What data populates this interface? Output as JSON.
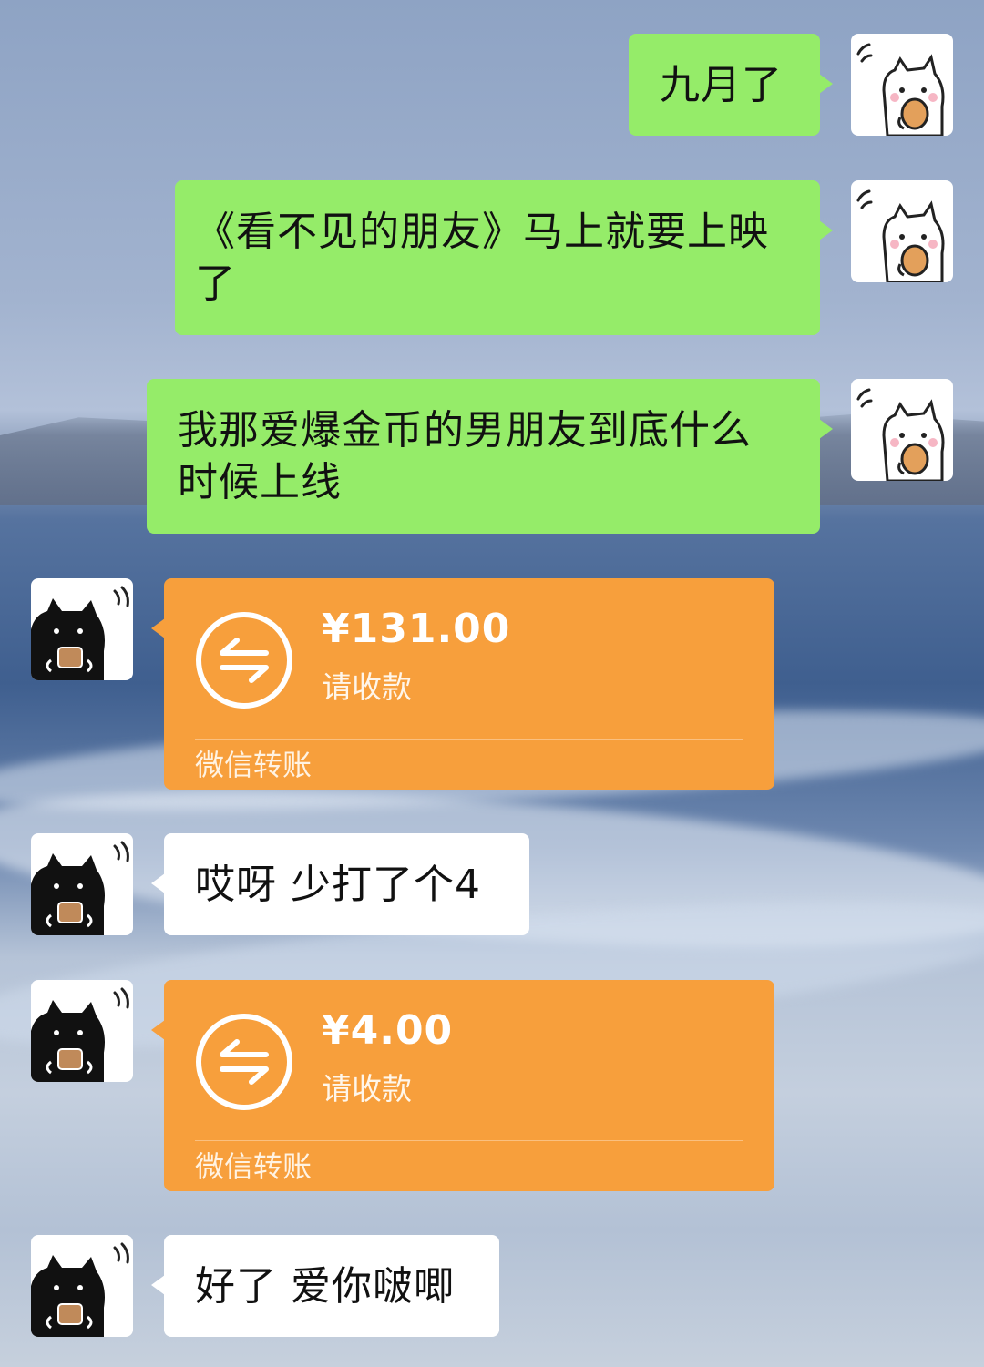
{
  "messages": [
    {
      "side": "right",
      "type": "text",
      "text": "九月了",
      "avatar": "white-cat-avatar"
    },
    {
      "side": "right",
      "type": "text",
      "text": "《看不见的朋友》马上就要上映了",
      "avatar": "white-cat-avatar"
    },
    {
      "side": "right",
      "type": "text",
      "text": "我那爱爆金币的男朋友到底什么时候上线",
      "avatar": "white-cat-avatar"
    },
    {
      "side": "left",
      "type": "transfer",
      "amount": "¥131.00",
      "status": "请收款",
      "footer": "微信转账",
      "avatar": "black-cat-avatar"
    },
    {
      "side": "left",
      "type": "text",
      "text": "哎呀 少打了个4",
      "avatar": "black-cat-avatar"
    },
    {
      "side": "left",
      "type": "transfer",
      "amount": "¥4.00",
      "status": "请收款",
      "footer": "微信转账",
      "avatar": "black-cat-avatar"
    },
    {
      "side": "left",
      "type": "text",
      "text": "好了 爱你啵唧",
      "avatar": "black-cat-avatar"
    }
  ],
  "colors": {
    "outgoing_bubble": "#95ec69",
    "incoming_bubble": "#ffffff",
    "transfer_card": "#f79f3c"
  },
  "icons": {
    "transfer": "transfer-arrows-icon"
  }
}
